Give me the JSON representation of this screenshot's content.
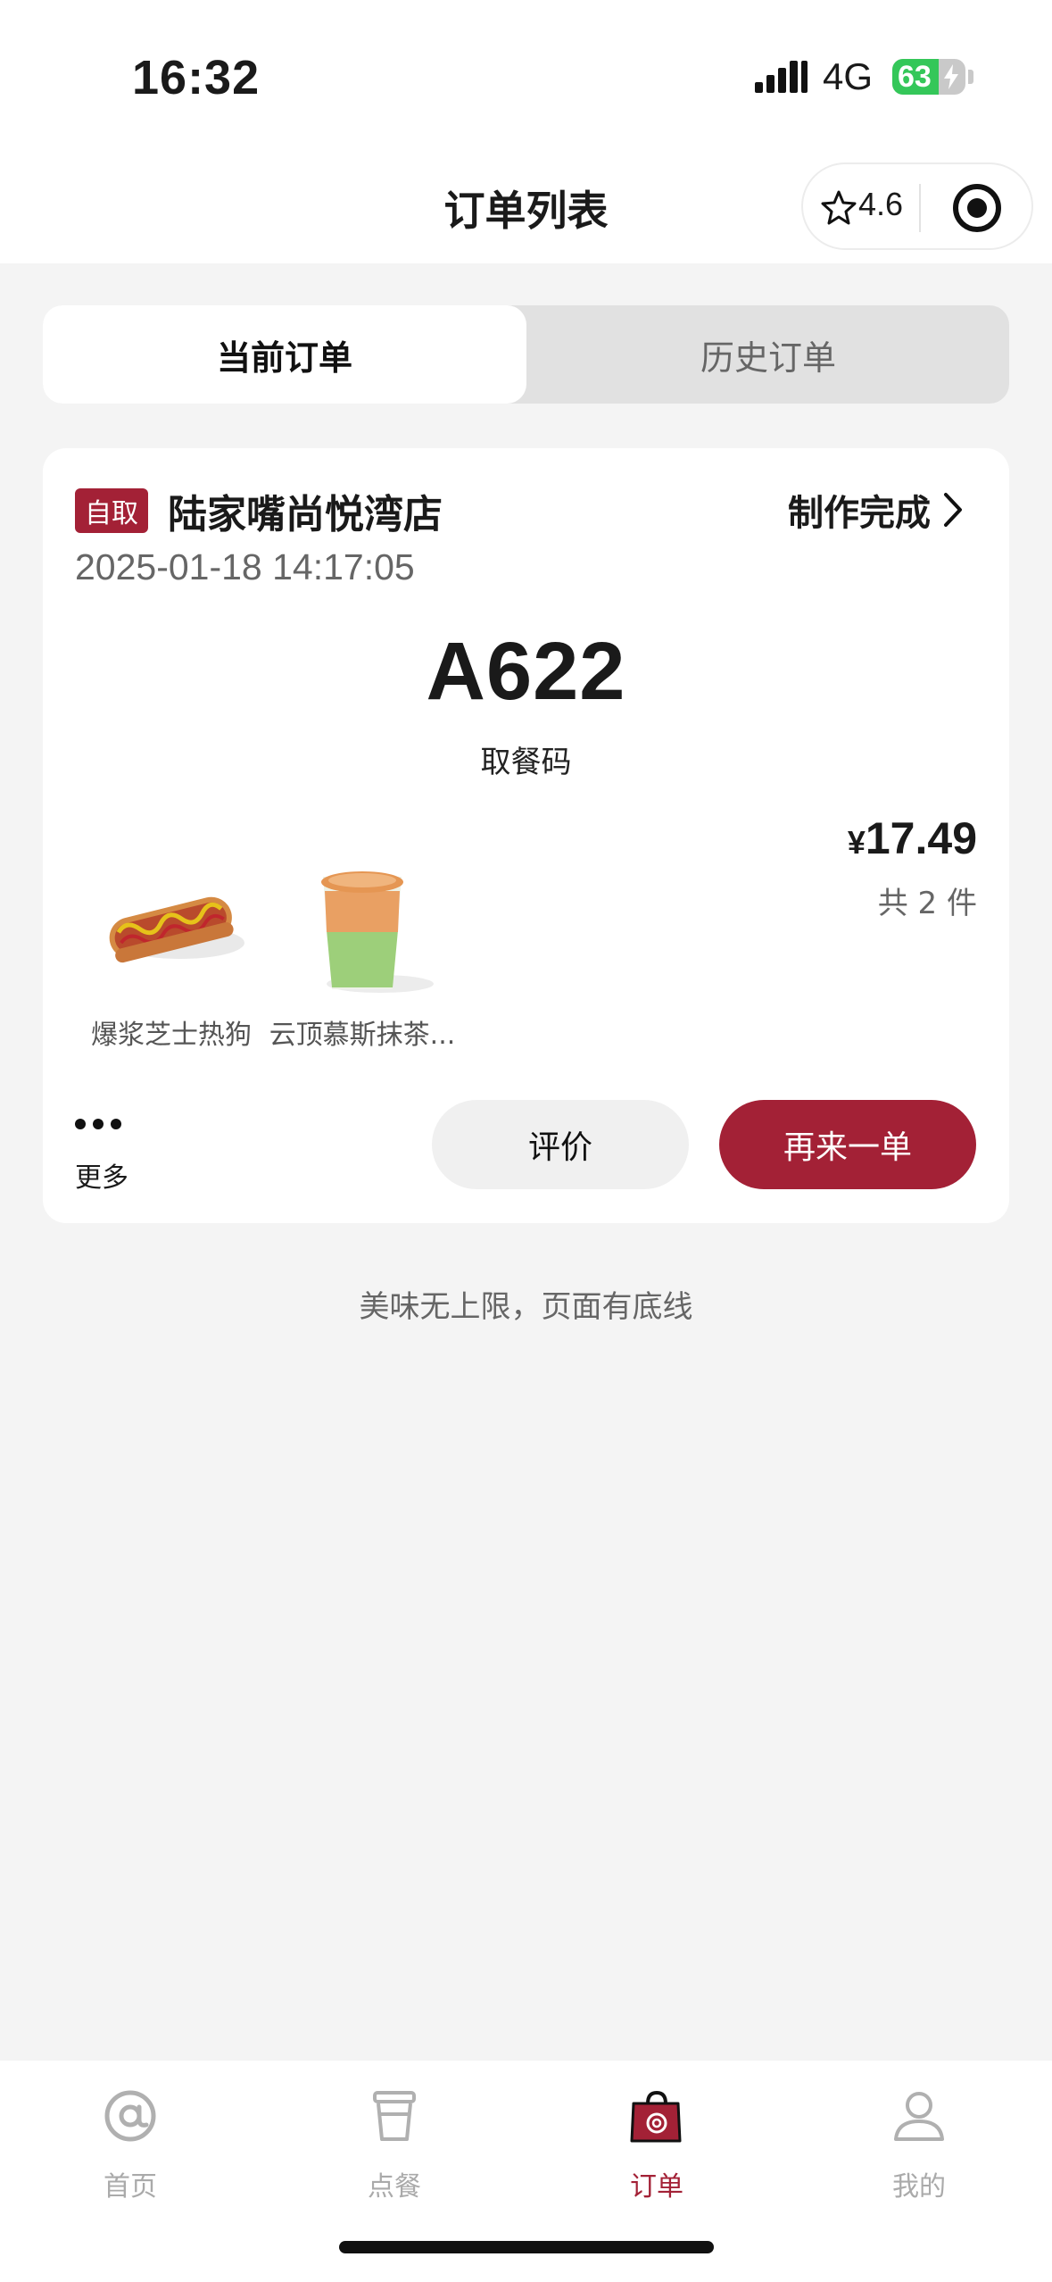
{
  "status_bar": {
    "time": "16:32",
    "network": "4G",
    "battery": "63"
  },
  "nav": {
    "title": "订单列表",
    "rating": "4.6"
  },
  "tabs": [
    {
      "label": "当前订单",
      "active": true
    },
    {
      "label": "历史订单",
      "active": false
    }
  ],
  "order": {
    "type_badge": "自取",
    "store": "陆家嘴尚悦湾店",
    "status": "制作完成",
    "datetime": "2025-01-18 14:17:05",
    "pickup_code": "A622",
    "pickup_code_label": "取餐码",
    "currency": "¥",
    "price": "17.49",
    "item_count": "共 2 件",
    "items": [
      {
        "name": "爆浆芝士热狗",
        "icon": "hotdog-image"
      },
      {
        "name": "云顶慕斯抹茶...",
        "icon": "matcha-drink-image"
      }
    ],
    "more_label": "更多",
    "review_label": "评价",
    "reorder_label": "再来一单"
  },
  "footer_note": "美味无上限，页面有底线",
  "tabbar": {
    "items": [
      {
        "label": "首页",
        "icon": "at-icon"
      },
      {
        "label": "点餐",
        "icon": "cup-icon"
      },
      {
        "label": "订单",
        "icon": "bag-icon",
        "active": true
      },
      {
        "label": "我的",
        "icon": "person-icon"
      }
    ]
  },
  "colors": {
    "brand": "#a32136",
    "background": "#f4f4f4",
    "battery_green": "#34c759"
  }
}
